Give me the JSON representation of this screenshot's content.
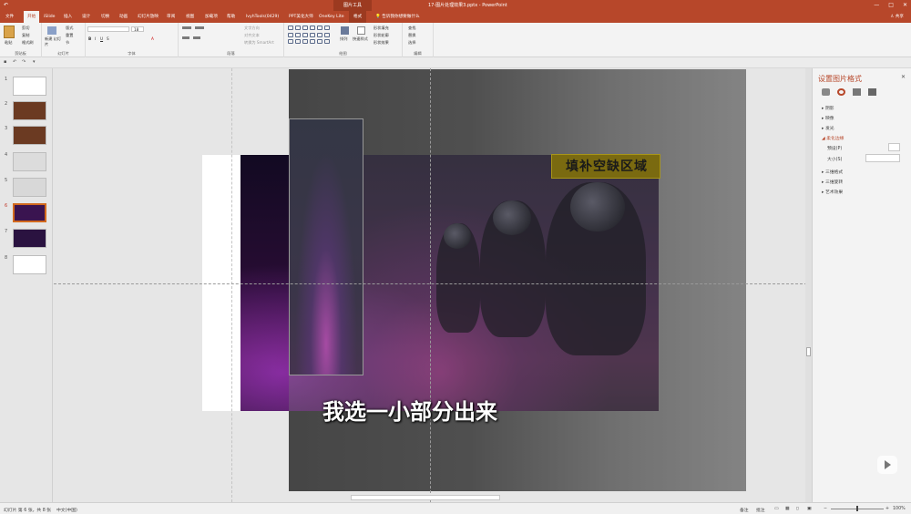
{
  "titlebar": {
    "context_tool": "图片工具",
    "document_title": "17-图片处理效果3.pptx - PowerPoint",
    "minimize": "—",
    "restore": "□",
    "close": "✕",
    "quick_access": "↶"
  },
  "tabs": [
    {
      "label": "文件"
    },
    {
      "label": "开始"
    },
    {
      "label": "iSlide"
    },
    {
      "label": "插入"
    },
    {
      "label": "设计"
    },
    {
      "label": "切换"
    },
    {
      "label": "动画"
    },
    {
      "label": "幻灯片放映"
    },
    {
      "label": "审阅"
    },
    {
      "label": "视图"
    },
    {
      "label": "加载项"
    },
    {
      "label": "帮助"
    },
    {
      "label": "lvyhTools(0429)"
    },
    {
      "label": "PPT美化大师"
    },
    {
      "label": "OneKey Lite"
    },
    {
      "label": "格式"
    }
  ],
  "tell_me": "告诉我你想要做什么",
  "share": "共享",
  "ribbon": {
    "clipboard": {
      "paste": "粘贴",
      "cut": "剪切",
      "copy": "复制",
      "format_painter": "格式刷",
      "label": "剪贴板"
    },
    "slides": {
      "new_slide": "新建 幻灯片",
      "layout": "版式",
      "reset": "重置",
      "section": "节",
      "label": "幻灯片"
    },
    "font": {
      "font_name": "",
      "font_size": "18",
      "label": "字体"
    },
    "paragraph": {
      "text_direction": "文字方向",
      "align_text": "对齐文本",
      "smartart": "转换为 SmartArt",
      "label": "段落"
    },
    "drawing": {
      "arrange": "排列",
      "quick_styles": "快速样式",
      "shape_fill": "形状填充",
      "shape_outline": "形状轮廓",
      "shape_effects": "形状效果",
      "label": "绘图"
    },
    "editing": {
      "find": "查找",
      "replace": "替换",
      "select": "选择",
      "label": "编辑"
    }
  },
  "thumbnails": [
    {
      "num": "1",
      "bg": "#ffffff"
    },
    {
      "num": "2",
      "bg": "#6b3a22"
    },
    {
      "num": "3",
      "bg": "#6b3a22"
    },
    {
      "num": "4",
      "bg": "#dcdcdc"
    },
    {
      "num": "5",
      "bg": "#d8d8d8"
    },
    {
      "num": "6",
      "bg": "#3a1450"
    },
    {
      "num": "7",
      "bg": "#2a1240"
    },
    {
      "num": "8",
      "bg": "#ffffff"
    }
  ],
  "slide": {
    "banner_text": "填补空缺区域"
  },
  "subtitle": "我选一小部分出来",
  "format_pane": {
    "title": "设置图片格式",
    "close": "✕",
    "sections": [
      {
        "label": "阴影"
      },
      {
        "label": "映像"
      },
      {
        "label": "发光"
      },
      {
        "label": "柔化边缘"
      },
      {
        "label": "三维格式"
      },
      {
        "label": "三维旋转"
      },
      {
        "label": "艺术效果"
      }
    ],
    "preset_label": "预设(P)",
    "size_label": "大小(S)"
  },
  "statusbar": {
    "slide_info": "幻灯片 第 6 张，共 8 张",
    "language": "中文(中国)",
    "notes": "备注",
    "comments": "批注",
    "zoom": "100%"
  }
}
